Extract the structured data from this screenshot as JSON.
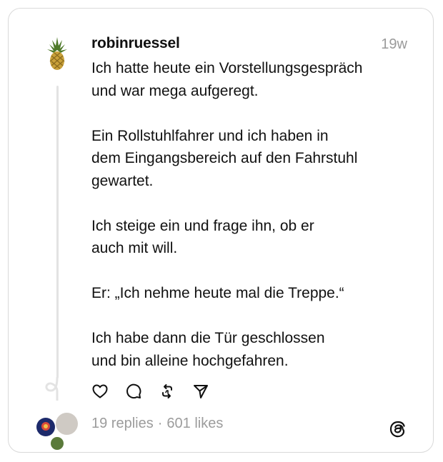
{
  "post": {
    "username": "robinruessel",
    "time": "19w",
    "paragraphs": [
      [
        "Ich hatte heute ein Vorstellungsgespräch",
        "und war mega aufgeregt."
      ],
      [
        "Ein Rollstuhlfahrer und ich haben in",
        "dem Eingangsbereich auf den Fahrstuhl",
        "gewartet."
      ],
      [
        "Ich steige ein und frage ihn, ob er",
        "auch mit will."
      ],
      [
        "Er: „Ich nehme heute mal die Treppe.“"
      ],
      [
        "Ich habe dann die Tür geschlossen",
        "und bin alleine hochgefahren."
      ]
    ],
    "replies": "19 replies",
    "separator": "·",
    "likes": "601 likes"
  },
  "icons": {
    "like": "heart-icon",
    "comment": "comment-icon",
    "repost": "repost-icon",
    "share": "send-icon",
    "brand": "threads-logo-icon"
  }
}
